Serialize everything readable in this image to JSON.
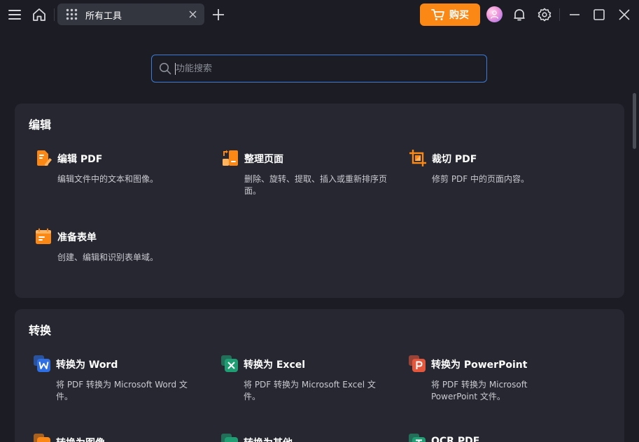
{
  "titlebar": {
    "tab_title": "所有工具",
    "buy_label": "购买"
  },
  "search": {
    "placeholder": "功能搜索",
    "value": ""
  },
  "sections": {
    "edit": {
      "title": "编辑",
      "tools": [
        {
          "name": "编辑 PDF",
          "desc": "编辑文件中的文本和图像。",
          "icon": "edit-pdf-icon"
        },
        {
          "name": "整理页面",
          "desc": "删除、旋转、提取、插入或重新排序页面。",
          "icon": "organize-pages-icon"
        },
        {
          "name": "裁切 PDF",
          "desc": "修剪 PDF 中的页面内容。",
          "icon": "crop-pdf-icon"
        },
        {
          "name": "准备表单",
          "desc": "创建、编辑和识别表单域。",
          "icon": "prepare-form-icon"
        }
      ]
    },
    "convert": {
      "title": "转换",
      "tools": [
        {
          "name": "转换为 Word",
          "desc": "将 PDF 转换为 Microsoft Word 文件。",
          "icon": "word-icon"
        },
        {
          "name": "转换为 Excel",
          "desc": "将 PDF 转换为 Microsoft Excel 文件。",
          "icon": "excel-icon"
        },
        {
          "name": "转换为 PowerPoint",
          "desc": "将 PDF 转换为 Microsoft PowerPoint 文件。",
          "icon": "powerpoint-icon"
        },
        {
          "name": "转换为图像",
          "desc": "",
          "icon": "image-icon"
        },
        {
          "name": "转换为其他",
          "desc": "",
          "icon": "other-format-icon"
        },
        {
          "name": "OCR PDF",
          "desc": "",
          "icon": "ocr-icon"
        }
      ]
    }
  },
  "colors": {
    "background": "#1b1c24",
    "card": "#262731",
    "accent_orange": "#fb8715",
    "search_border": "#3d7bd6",
    "word": "#2f6fe4",
    "excel": "#1f9e74",
    "powerpoint": "#e4573d"
  }
}
